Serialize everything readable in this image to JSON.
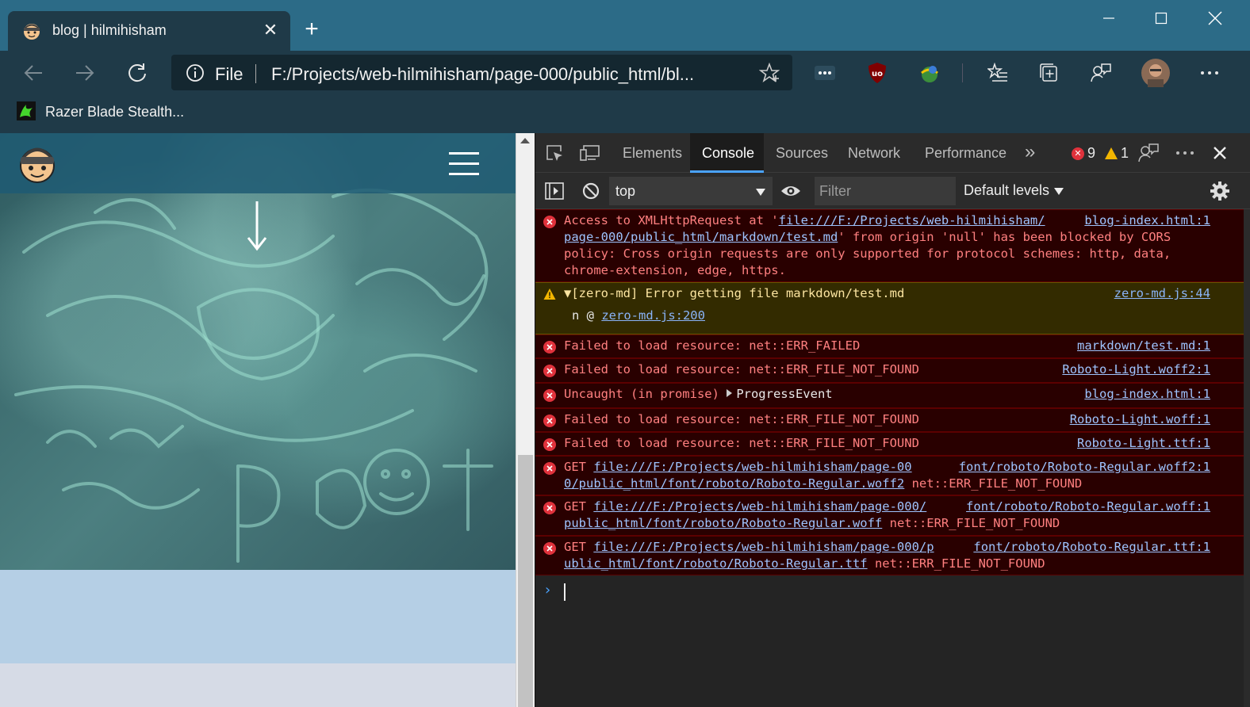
{
  "browser": {
    "tab": {
      "title": "blog | hilmihisham",
      "close": "✕"
    },
    "new_tab": "+",
    "window_controls": [
      "minimize",
      "maximize",
      "close"
    ],
    "address": {
      "scheme_label": "File",
      "url": "F:/Projects/web-hilmihisham/page-000/public_html/bl..."
    },
    "favorites": [
      {
        "label": "Razer Blade Stealth..."
      }
    ],
    "colors": {
      "titlebar": "#2c6b87",
      "toolbar": "#1f3a48"
    }
  },
  "page": {
    "icons": [
      "avatar-logo",
      "hamburger-menu-icon",
      "down-arrow-icon"
    ]
  },
  "devtools": {
    "tabs": [
      "Elements",
      "Console",
      "Sources",
      "Network",
      "Performance"
    ],
    "active_tab": "Console",
    "more_tabs": "»",
    "error_count": "9",
    "warning_count": "1",
    "console_toolbar": {
      "context": "top",
      "filter_placeholder": "Filter",
      "levels": "Default levels"
    },
    "messages": {
      "m0": {
        "line1": "Access to XMLHttpRequest at '",
        "link1": "file:///F:/Projects/web-hilmihisham/",
        "line2_link": "page-000/public_html/markdown/test.md",
        "line2_rest": "' from origin 'null' has been blocked by CORS",
        "line3": "policy: Cross origin requests are only supported for protocol schemes: http, data,",
        "line4": "chrome-extension, edge, https.",
        "src": "blog-index.html:1"
      },
      "m1": {
        "text": "[zero-md] Error getting file markdown/test.md",
        "expander": "▼",
        "src": "zero-md.js:44",
        "stack_prefix": "n @ ",
        "stack_link": "zero-md.js:200"
      },
      "m2": {
        "text": "Failed to load resource: net::ERR_FAILED",
        "src": "markdown/test.md:1"
      },
      "m3": {
        "text": "Failed to load resource: net::ERR_FILE_NOT_FOUND",
        "src": "Roboto-Light.woff2:1"
      },
      "m4": {
        "text": "Uncaught (in promise) ",
        "obj": "ProgressEvent",
        "src": "blog-index.html:1"
      },
      "m5": {
        "text": "Failed to load resource: net::ERR_FILE_NOT_FOUND",
        "src": "Roboto-Light.woff:1"
      },
      "m6": {
        "text": "Failed to load resource: net::ERR_FILE_NOT_FOUND",
        "src": "Roboto-Light.ttf:1"
      },
      "m7": {
        "verb": "GET ",
        "link1": "file:///F:/Projects/web-hilmihisham/page-00",
        "link2": "0/public_html/font/roboto/Roboto-Regular.woff2",
        "rest": " net::ERR_FILE_NOT_FOUND",
        "src": "font/roboto/Roboto-Regular.woff2:1"
      },
      "m8": {
        "verb": "GET ",
        "link1": "file:///F:/Projects/web-hilmihisham/page-000/",
        "link2": "public_html/font/roboto/Roboto-Regular.woff",
        "rest": " net::ERR_FILE_NOT_FOUND",
        "src": "font/roboto/Roboto-Regular.woff:1"
      },
      "m9": {
        "verb": "GET ",
        "link1": "file:///F:/Projects/web-hilmihisham/page-000/p",
        "link2": "ublic_html/font/roboto/Roboto-Regular.ttf",
        "rest": " net::ERR_FILE_NOT_FOUND",
        "src": "font/roboto/Roboto-Regular.ttf:1"
      }
    },
    "prompt": "›"
  }
}
